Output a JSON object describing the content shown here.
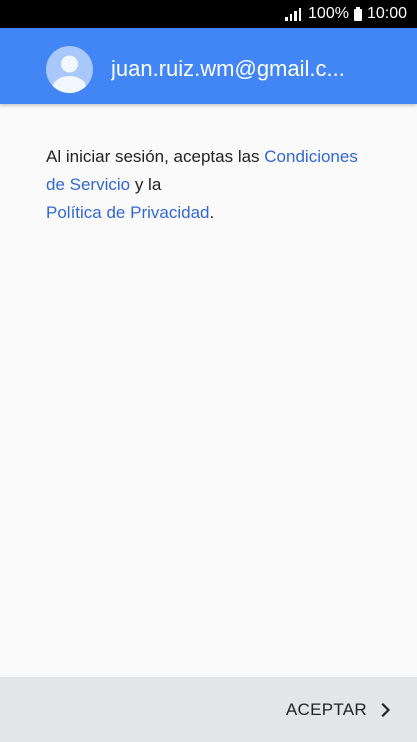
{
  "status_bar": {
    "battery_percent": "100%",
    "time": "10:00"
  },
  "header": {
    "email": "juan.ruiz.wm@gmail.c...",
    "avatar_icon": "account-circle-icon",
    "background_color": "#4285f4"
  },
  "terms": {
    "text_before": "Al iniciar sesión, aceptas las ",
    "terms_link": "Condiciones de Servicio",
    "text_middle": " y la ",
    "privacy_link": "Política de Privacidad",
    "text_after": ".",
    "link_color": "#3367d6"
  },
  "footer": {
    "accept_label": "ACEPTAR",
    "accept_icon": "chevron-right-icon"
  }
}
